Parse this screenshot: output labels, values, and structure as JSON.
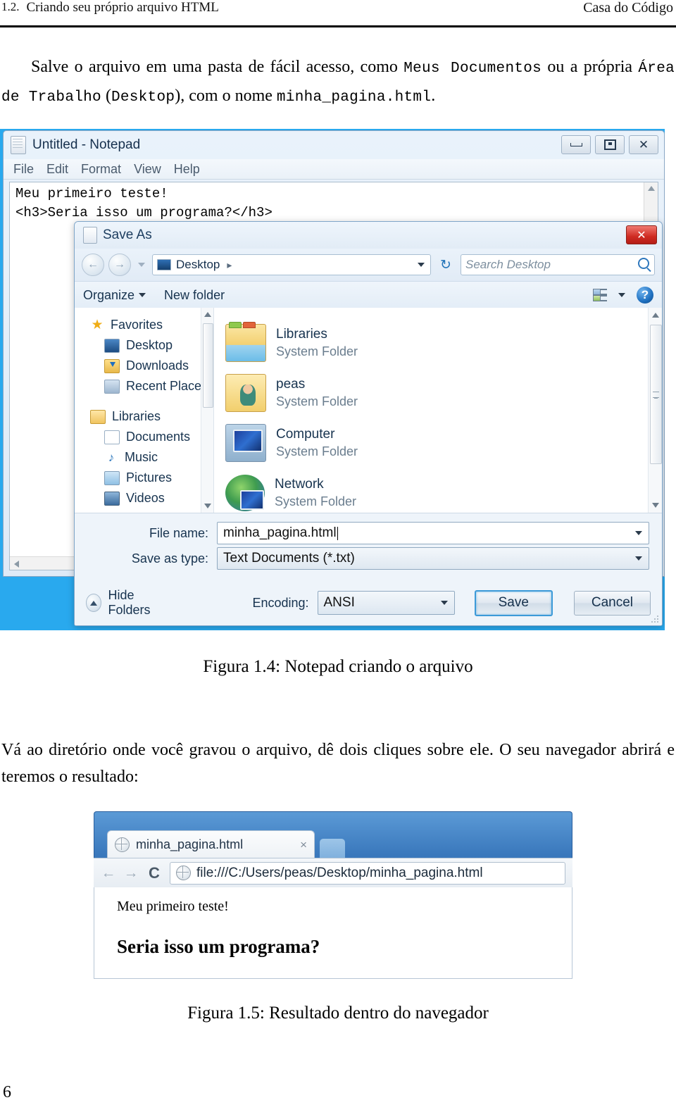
{
  "header": {
    "section_number": "1.2.",
    "section_title": "Criando seu próprio arquivo HTML",
    "publisher": "Casa do Código"
  },
  "intro_paragraph": {
    "part1": "Salve o arquivo em uma pasta de fácil acesso, como ",
    "mono1": "Meus Documentos",
    "part2": " ou a própria ",
    "mono2": "Área de Trabalho",
    "part3": " (",
    "mono3": "Desktop",
    "part4": "), com o nome ",
    "mono4": "minha_pagina.html",
    "part5": "."
  },
  "notepad": {
    "title": "Untitled - Notepad",
    "window_buttons": {
      "minimize": "minimize-button",
      "maximize": "restore-button",
      "close": "close-button"
    },
    "menu": [
      "File",
      "Edit",
      "Format",
      "View",
      "Help"
    ],
    "content_line1": "Meu primeiro teste!",
    "content_line2": "<h3>Seria isso um programa?</h3>"
  },
  "save_dialog": {
    "title": "Save As",
    "close_label": "✕",
    "address": "Desktop",
    "address_separator": "▸",
    "search_placeholder": "Search Desktop",
    "toolbar": {
      "organize": "Organize",
      "new_folder": "New folder"
    },
    "sidebar": {
      "favorites_group": "Favorites",
      "favorites": [
        "Desktop",
        "Downloads",
        "Recent Places"
      ],
      "libraries_group": "Libraries",
      "libraries": [
        "Documents",
        "Music",
        "Pictures",
        "Videos"
      ]
    },
    "files": [
      {
        "name": "Libraries",
        "type": "System Folder"
      },
      {
        "name": "peas",
        "type": "System Folder"
      },
      {
        "name": "Computer",
        "type": "System Folder"
      },
      {
        "name": "Network",
        "type": "System Folder"
      }
    ],
    "file_name_label": "File name:",
    "file_name_value": "minha_pagina.html",
    "save_as_type_label": "Save as type:",
    "save_as_type_value": "Text Documents (*.txt)",
    "hide_folders_label": "Hide Folders",
    "encoding_label": "Encoding:",
    "encoding_value": "ANSI",
    "save_button": "Save",
    "cancel_button": "Cancel"
  },
  "caption_figure_14": "Figura 1.4: Notepad criando o arquivo",
  "browser_paragraph": {
    "text": "Vá ao diretório onde você gravou o arquivo, dê dois cliques sobre ele.  O seu navegador abrirá e teremos o resultado:"
  },
  "browser": {
    "tab_title": "minha_pagina.html",
    "tab_close": "×",
    "back_arrow": "←",
    "forward_arrow": "→",
    "reload": "C",
    "url": "file:///C:/Users/peas/Desktop/minha_pagina.html",
    "page_text": "Meu primeiro teste!",
    "page_heading": "Seria isso um programa?"
  },
  "caption_figure_15": "Figura 1.5: Resultado dentro do navegador",
  "page_number": "6",
  "colors": {
    "desktop_blue": "#29a9ee",
    "chrome_blue": "#3b79bd",
    "close_red": "#cf2b22",
    "accent_focus": "#3c9ad8"
  }
}
